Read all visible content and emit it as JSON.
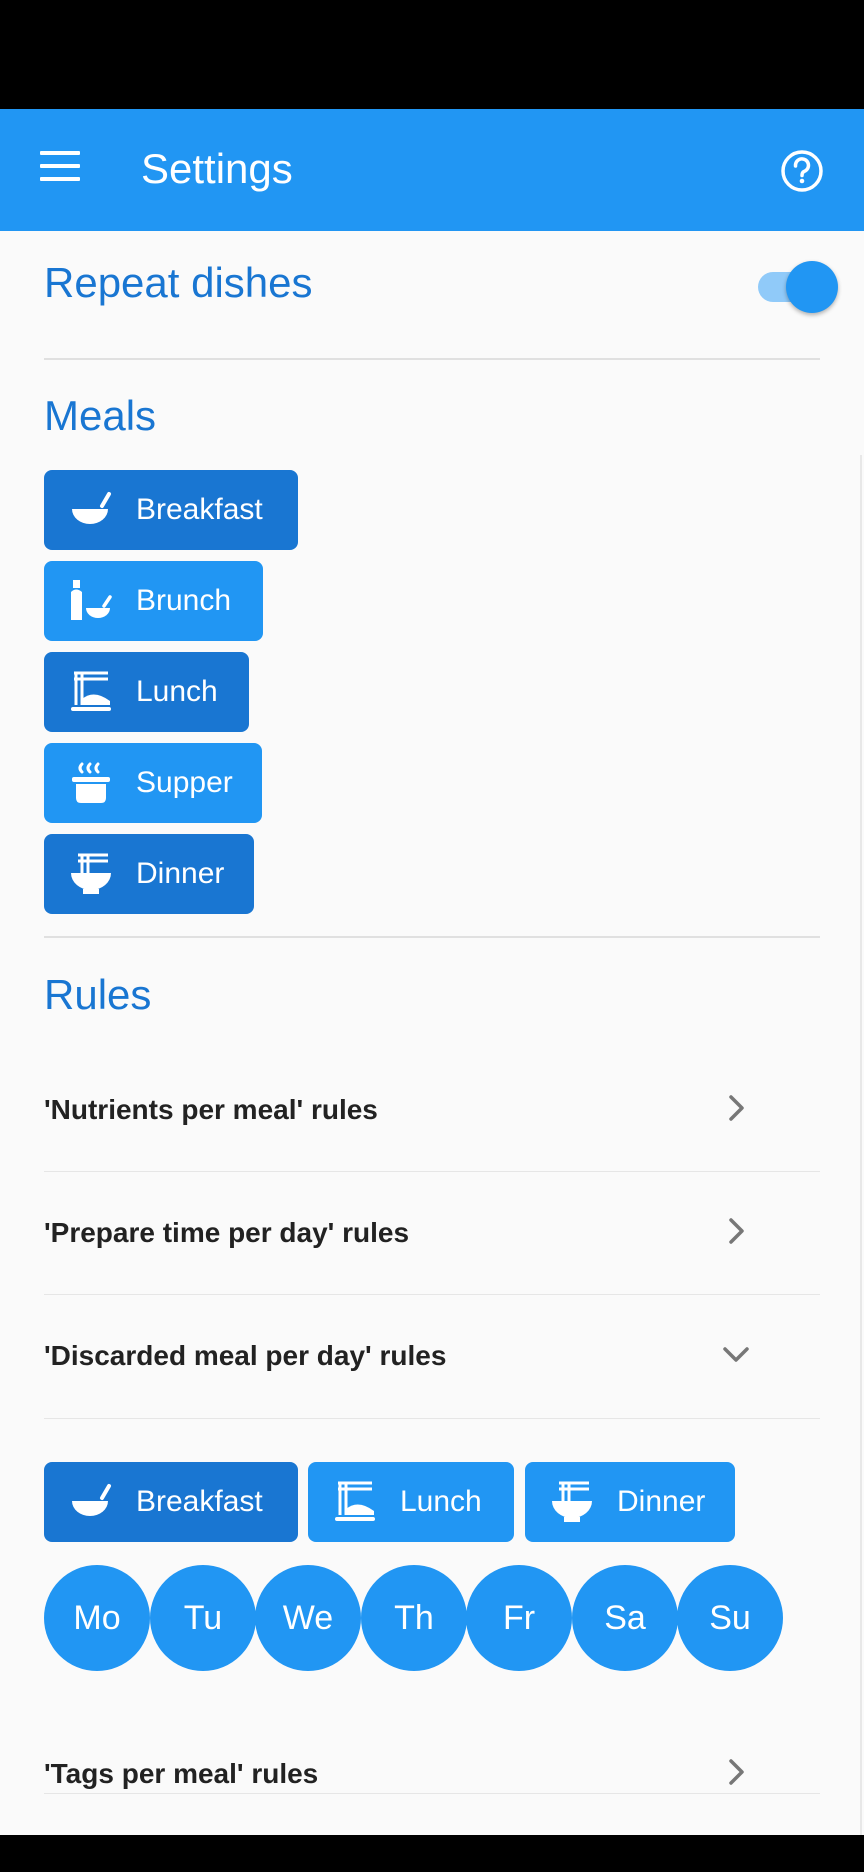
{
  "appbar": {
    "title": "Settings",
    "menu_icon": "menu-icon",
    "help_icon": "help-circle-icon"
  },
  "repeat_dishes": {
    "title": "Repeat dishes",
    "enabled": true
  },
  "meals": {
    "title": "Meals",
    "items": [
      {
        "label": "Breakfast",
        "icon": "bowl-icon",
        "selected": true
      },
      {
        "label": "Brunch",
        "icon": "bottle-bowl-icon",
        "selected": false
      },
      {
        "label": "Lunch",
        "icon": "noodle-plate-icon",
        "selected": true
      },
      {
        "label": "Supper",
        "icon": "steaming-pot-icon",
        "selected": false
      },
      {
        "label": "Dinner",
        "icon": "noodle-bowl-icon",
        "selected": true
      }
    ]
  },
  "rules": {
    "title": "Rules",
    "items": [
      {
        "label": "'Nutrients per meal' rules",
        "expanded": false
      },
      {
        "label": "'Prepare time per day' rules",
        "expanded": false
      },
      {
        "label": "'Discarded meal per day' rules",
        "expanded": true
      },
      {
        "label": "'Tags per meal' rules",
        "expanded": false
      }
    ],
    "discarded_meals": [
      {
        "label": "Breakfast",
        "icon": "bowl-icon",
        "selected": true
      },
      {
        "label": "Lunch",
        "icon": "noodle-plate-icon",
        "selected": false
      },
      {
        "label": "Dinner",
        "icon": "noodle-bowl-icon",
        "selected": false
      }
    ],
    "days": [
      "Mo",
      "Tu",
      "We",
      "Th",
      "Fr",
      "Sa",
      "Su"
    ]
  },
  "colors": {
    "primary": "#2196f3",
    "primary_dark": "#1976d2",
    "accent_light": "#90caf9"
  }
}
